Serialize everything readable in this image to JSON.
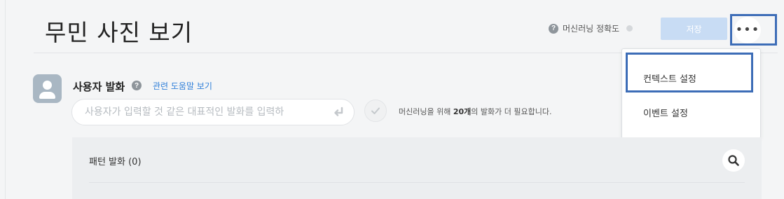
{
  "header": {
    "title": "무민 사진 보기",
    "accuracy_label": "머신러닝 정확도",
    "save_label": "저장",
    "more_label": "•••"
  },
  "dropdown": {
    "items": [
      {
        "label": "컨텍스트 설정"
      },
      {
        "label": "이벤트 설정"
      }
    ]
  },
  "utterance": {
    "section_label": "사용자 발화",
    "help_link": "관련 도움말 보기",
    "input_placeholder": "사용자가 입력할 것 같은 대표적인 발화를 입력하",
    "note_prefix": "머신러닝을 위해 ",
    "note_count": "20개",
    "note_suffix": "의 발화가 더 필요합니다."
  },
  "pattern": {
    "title": "패턴 발화 (0)"
  },
  "icons": {
    "help": "?",
    "search": "search-icon",
    "check": "check-icon",
    "enter": "enter-icon",
    "avatar": "user-avatar-icon"
  },
  "colors": {
    "accent_link": "#2f7fd9",
    "save_disabled": "#c8dcf4",
    "highlight_box": "#3d6db7",
    "avatar_bg": "#a9b7c3"
  }
}
